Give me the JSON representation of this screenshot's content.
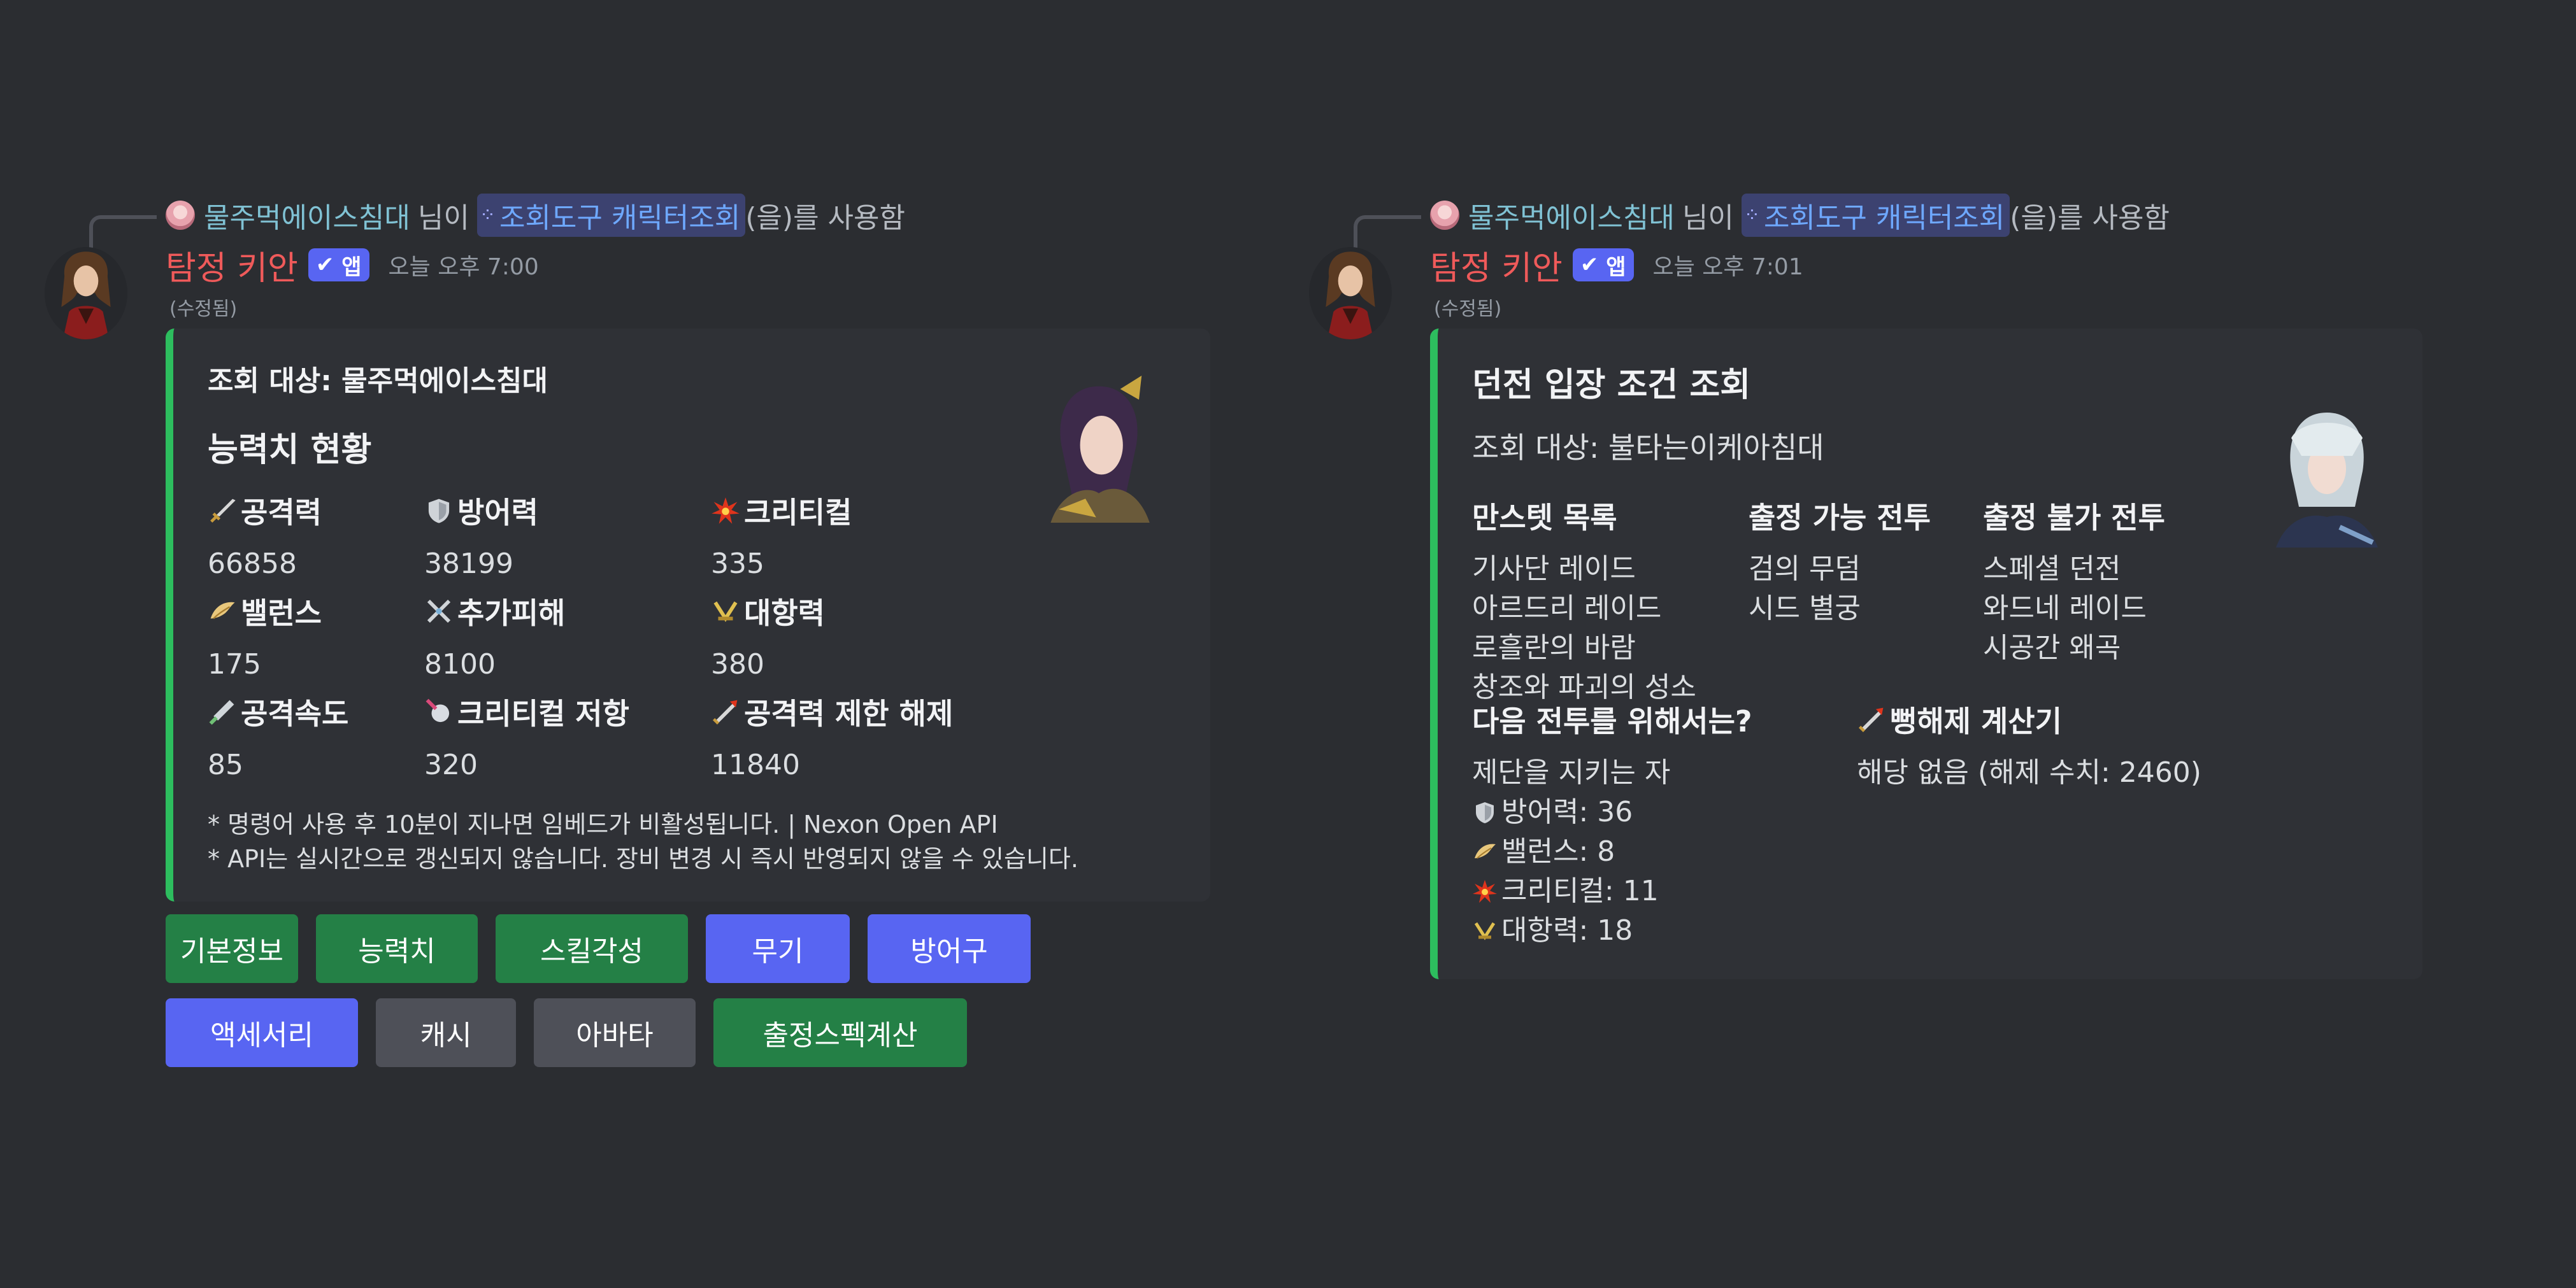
{
  "left_message": {
    "reply": {
      "user": "물주먹에이스침대",
      "suffix_nim": "님이",
      "command": "조회도구 캐릭터조회",
      "used_text": "(을)를 사용함"
    },
    "bot_name": "탐정 키안",
    "badge": "앱",
    "time": "오늘 오후 7:00",
    "edited": "(수정됨)",
    "embed": {
      "author": "조회 대상: 물주먹에이스침대",
      "title": "능력치 현황",
      "fields": [
        {
          "name": "공격력",
          "value": "66858",
          "icon": "sword-icon"
        },
        {
          "name": "방어력",
          "value": "38199",
          "icon": "shield-icon"
        },
        {
          "name": "크리티컬",
          "value": "335",
          "icon": "critical-burst-icon"
        },
        {
          "name": "밸런스",
          "value": "175",
          "icon": "wing-icon"
        },
        {
          "name": "추가피해",
          "value": "8100",
          "icon": "crossed-swords-icon"
        },
        {
          "name": "대항력",
          "value": "380",
          "icon": "resist-icon"
        },
        {
          "name": "공격속도",
          "value": "85",
          "icon": "speed-sword-icon"
        },
        {
          "name": "크리티컬 저항",
          "value": "320",
          "icon": "crit-resist-icon"
        },
        {
          "name": "공격력 제한 해제",
          "value": "11840",
          "icon": "limit-break-icon"
        }
      ],
      "footer_line1": "* 명령어 사용 후 10분이 지나면 임베드가 비활성됩니다. | Nexon Open API",
      "footer_line2": "* API는 실시간으로 갱신되지 않습니다. 장비 변경 시 즉시 반영되지 않을 수 있습니다."
    },
    "buttons_row1": [
      {
        "label": "기본정보",
        "style": "green"
      },
      {
        "label": "능력치",
        "style": "green"
      },
      {
        "label": "스킬각성",
        "style": "green"
      },
      {
        "label": "무기",
        "style": "blurple"
      },
      {
        "label": "방어구",
        "style": "blurple"
      }
    ],
    "buttons_row2": [
      {
        "label": "액세서리",
        "style": "blurple"
      },
      {
        "label": "캐시",
        "style": "grey"
      },
      {
        "label": "아바타",
        "style": "grey"
      },
      {
        "label": "출정스펙계산",
        "style": "green"
      }
    ]
  },
  "right_message": {
    "reply": {
      "user": "물주먹에이스침대",
      "suffix_nim": "님이",
      "command": "조회도구 캐릭터조회",
      "used_text": "(을)를 사용함"
    },
    "bot_name": "탐정 키안",
    "badge": "앱",
    "time": "오늘 오후 7:01",
    "edited": "(수정됨)",
    "embed": {
      "title": "던전 입장 조건 조회",
      "description": "조회 대상: 불타는이케아침대",
      "col1": {
        "name": "만스텟 목록",
        "lines": [
          "기사단 레이드",
          "아르드리 레이드",
          "로흘란의 바람",
          "창조와 파괴의 성소"
        ]
      },
      "col2": {
        "name": "출정 가능 전투",
        "lines": [
          "검의 무덤",
          "시드 별궁"
        ]
      },
      "col3": {
        "name": "출정 불가 전투",
        "lines": [
          "스페셜 던전",
          "와드네 레이드",
          "시공간 왜곡"
        ]
      },
      "col4": {
        "name": "다음 전투를 위해서는?",
        "first_line": "제단을 지키는 자",
        "stats": [
          {
            "icon": "shield-icon",
            "text": "방어력: 36"
          },
          {
            "icon": "wing-icon",
            "text": "밸런스: 8"
          },
          {
            "icon": "critical-burst-icon",
            "text": "크리티컬: 11"
          },
          {
            "icon": "resist-icon",
            "text": "대항력: 18"
          }
        ]
      },
      "col5": {
        "name": "뻥해제 계산기",
        "icon": "limit-break-icon",
        "value": "해당 없음 (해제 수치: 2460)"
      }
    }
  },
  "colors": {
    "background": "#2b2d31",
    "embed": "#2f3136",
    "embed_bar": "#2dbd5e",
    "bot_name": "#ef5a5a",
    "green": "#248046",
    "blurple": "#5865f2",
    "grey": "#4e5058"
  }
}
